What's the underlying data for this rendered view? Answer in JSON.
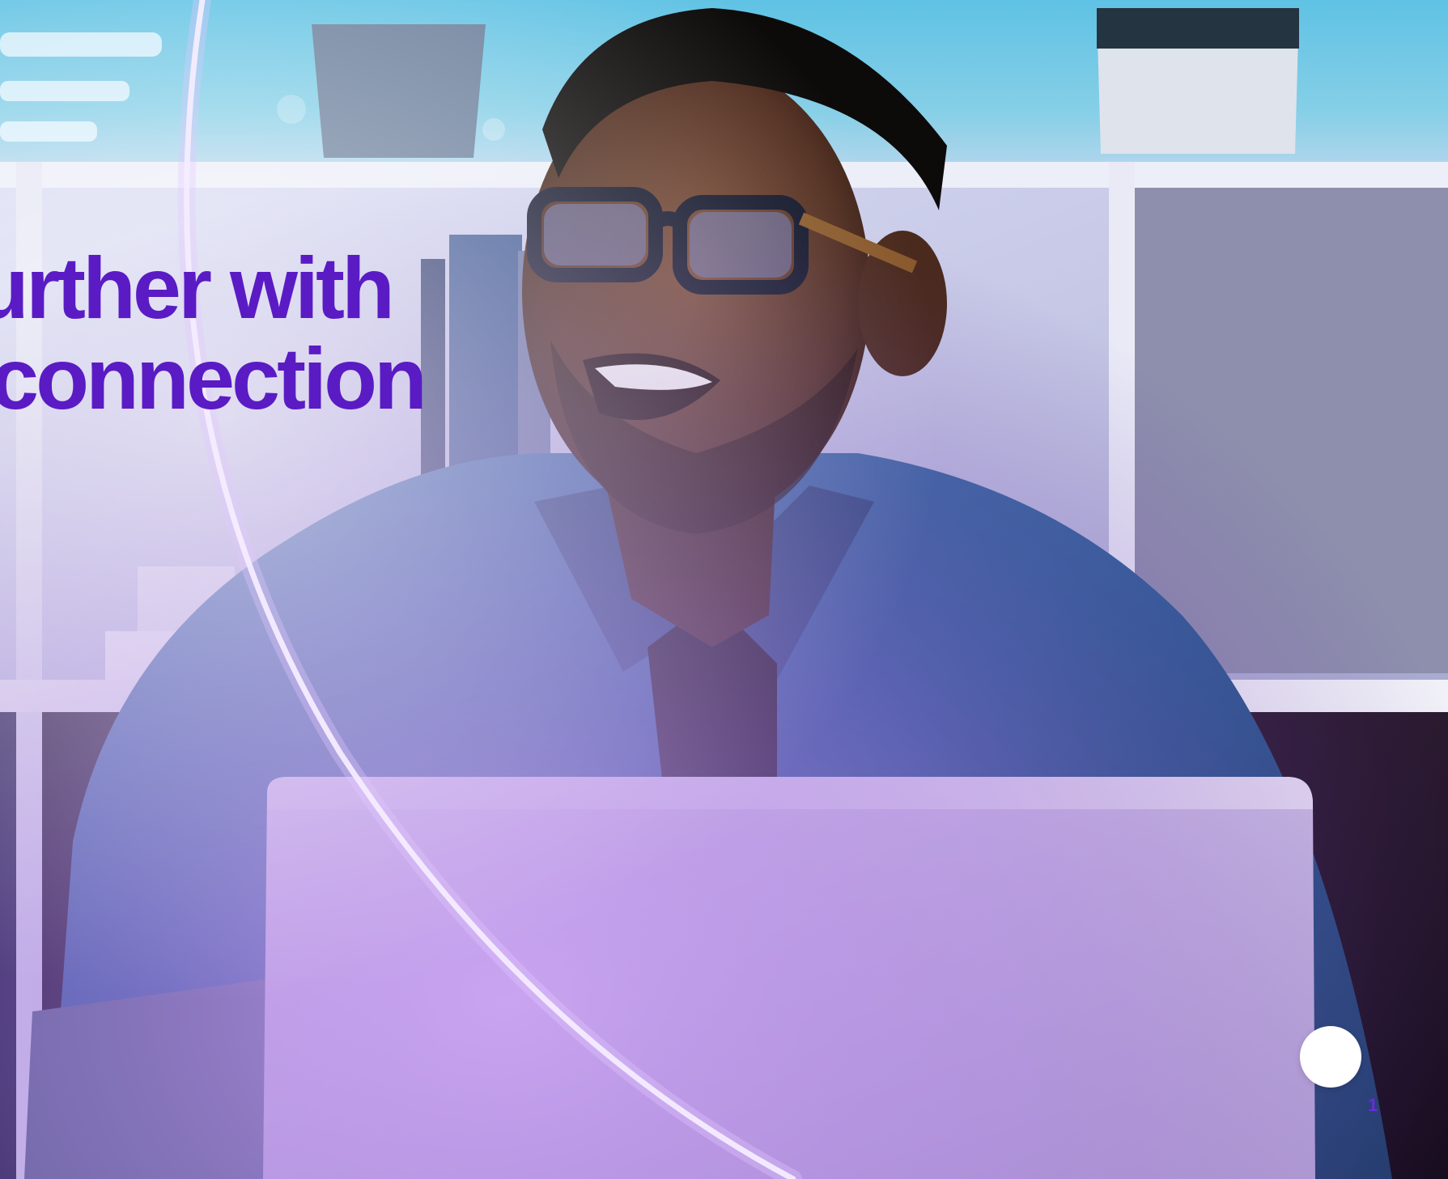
{
  "headline": {
    "line1": "urther with",
    "line2": "connection"
  },
  "page": {
    "number": "1"
  },
  "colors": {
    "headline": "#5a1bc4",
    "page_number": "#6a2bd6",
    "accent_glow": "#e9ddff"
  },
  "photo": {
    "description_icon": "person-at-laptop-photo"
  }
}
